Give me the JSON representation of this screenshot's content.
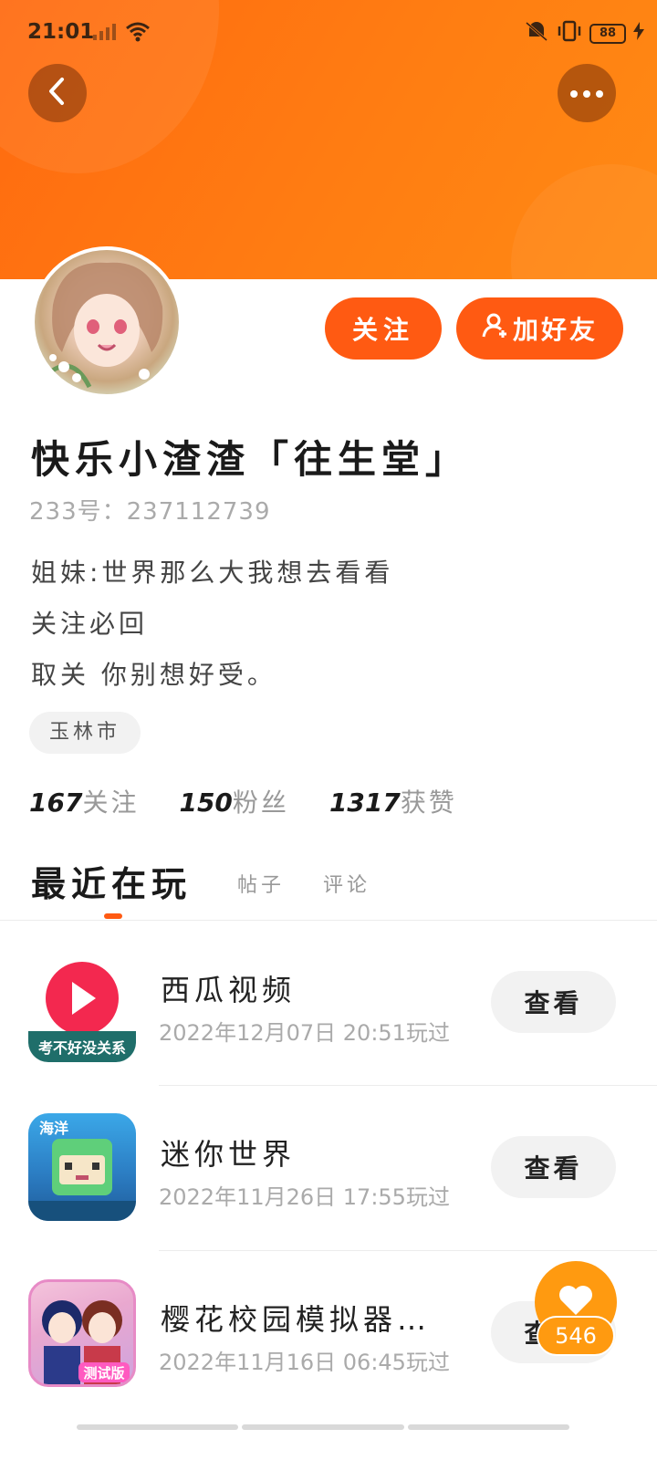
{
  "status_bar": {
    "time": "21:01",
    "battery": "88"
  },
  "header": {
    "back_icon": "chevron-left-icon",
    "more_icon": "more-dots-icon"
  },
  "profile": {
    "nickname": "快乐小渣渣「往生堂」",
    "uid": "233号：237112739",
    "bio": [
      "姐妹:世界那么大我想去看看",
      "关注必回",
      "取关 你别想好受。"
    ],
    "location": "玉林市",
    "follow_label": "关注",
    "add_friend_label": "加好友"
  },
  "stats": [
    {
      "num": "167",
      "label": "关注"
    },
    {
      "num": "150",
      "label": "粉丝"
    },
    {
      "num": "1317",
      "label": "获赞"
    }
  ],
  "tabs": {
    "active": "最近在玩",
    "posts": "帖子",
    "comments": "评论"
  },
  "games": [
    {
      "name": "西瓜视频",
      "time": "2022年12月07日 20:51玩过",
      "badge": "考不好没关系",
      "action": "查看"
    },
    {
      "name": "迷你世界",
      "time": "2022年11月26日 17:55玩过",
      "badge": "海洋",
      "action": "查看"
    },
    {
      "name": "樱花校园模拟器…",
      "time": "2022年11月16日 06:45玩过",
      "badge": "测试版",
      "action": "查看"
    }
  ],
  "like_fab": {
    "count": "546"
  },
  "colors": {
    "accent": "#ff5a12",
    "header": "#ff7d12",
    "fab": "#ff9a10"
  }
}
